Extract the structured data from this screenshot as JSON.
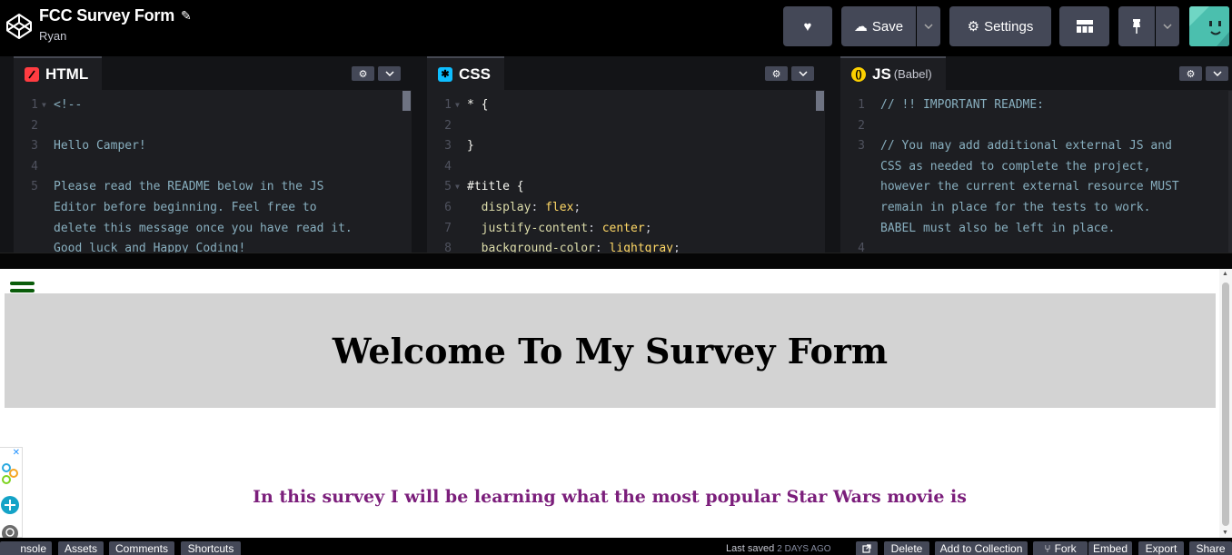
{
  "header": {
    "pen_title": "FCC Survey Form",
    "user": "Ryan",
    "buttons": {
      "save_label": "Save",
      "settings_label": "Settings"
    }
  },
  "editors": {
    "html": {
      "tab_label": "HTML",
      "lines": [
        {
          "n": "1",
          "text": "<!--",
          "fold": true
        },
        {
          "n": "2",
          "text": ""
        },
        {
          "n": "3",
          "text": "Hello Camper!"
        },
        {
          "n": "4",
          "text": ""
        },
        {
          "n": "5",
          "text": "Please read the README below in the JS"
        },
        {
          "n": "",
          "text": "Editor before beginning. Feel free to"
        },
        {
          "n": "",
          "text": "delete this message once you have read it."
        },
        {
          "n": "",
          "text": "Good luck and Happy Coding!"
        }
      ]
    },
    "css": {
      "tab_label": "CSS",
      "lines": [
        {
          "n": "1",
          "text": "* {",
          "fold": true
        },
        {
          "n": "2",
          "text": ""
        },
        {
          "n": "3",
          "text": "}"
        },
        {
          "n": "4",
          "text": ""
        },
        {
          "n": "5",
          "text": "#title {",
          "fold": true
        },
        {
          "n": "6",
          "prop": "  display",
          "val": "flex"
        },
        {
          "n": "7",
          "prop": "  justify-content",
          "val": "center"
        },
        {
          "n": "8",
          "prop": "  background-color",
          "val": "lightgray"
        }
      ]
    },
    "js": {
      "tab_label": "JS",
      "tab_sub": "(Babel)",
      "lines": [
        {
          "n": "1",
          "text": "// !! IMPORTANT README:"
        },
        {
          "n": "2",
          "text": ""
        },
        {
          "n": "3",
          "text": "// You may add additional external JS and"
        },
        {
          "n": "",
          "text": "CSS as needed to complete the project,"
        },
        {
          "n": "",
          "text": "however the current external resource MUST"
        },
        {
          "n": "",
          "text": "remain in place for the tests to work."
        },
        {
          "n": "",
          "text": "BABEL must also be left in place."
        },
        {
          "n": "4",
          "text": ""
        }
      ]
    }
  },
  "preview": {
    "title": "Welcome To My Survey Form",
    "description": "In this survey I will be learning what the most popular Star Wars movie is"
  },
  "footer": {
    "left_buttons": [
      "nsole",
      "Assets",
      "Comments",
      "Shortcuts"
    ],
    "last_saved_label": "Last saved",
    "last_saved_ago": "2 DAYS AGO",
    "right_buttons": [
      "Delete",
      "Add to Collection",
      "Fork",
      "Embed",
      "Export",
      "Share"
    ]
  },
  "colors": {
    "header_bg": "#000000",
    "button_bg": "#444857",
    "editor_bg": "#1d1e22",
    "html_badge": "#ff3c41",
    "css_badge": "#0ebeff",
    "js_badge": "#fcd000",
    "title_bg": "#d3d3d3",
    "description_color": "#7b1e7b",
    "hamburger_color": "#0a5c0a"
  }
}
